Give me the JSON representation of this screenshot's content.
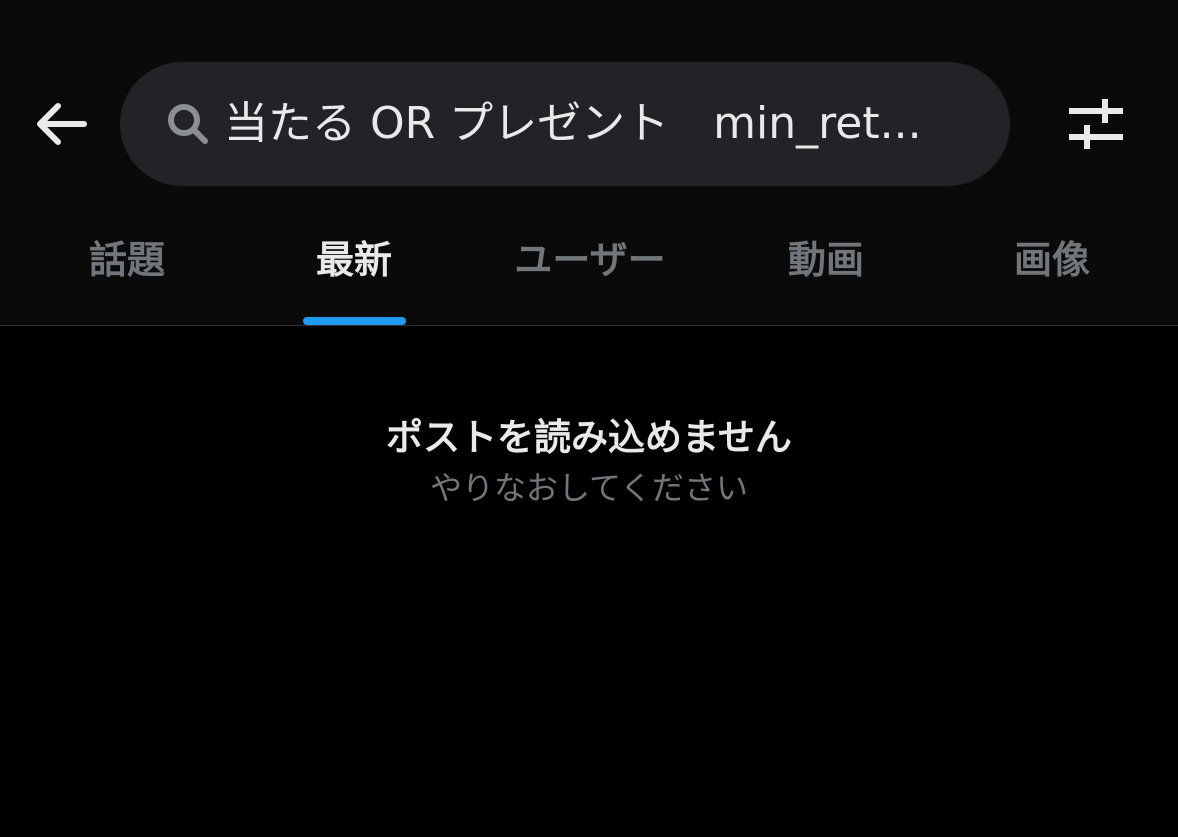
{
  "search": {
    "query": "当たる OR プレゼント　min_ret..."
  },
  "icons": {
    "back": "arrow-left-icon",
    "search": "search-icon",
    "filter": "sliders-icon"
  },
  "tabs": [
    {
      "label": "話題",
      "active": false
    },
    {
      "label": "最新",
      "active": true
    },
    {
      "label": "ユーザー",
      "active": false
    },
    {
      "label": "動画",
      "active": false
    },
    {
      "label": "画像",
      "active": false
    }
  ],
  "error": {
    "title": "ポストを読み込めません",
    "subtitle": "やりなおしてください"
  },
  "colors": {
    "background": "#000000",
    "header_background": "#0a0a0b",
    "search_background": "#212327",
    "accent": "#1d9bf0",
    "text_primary": "#e7e9ea",
    "text_secondary": "#71767b"
  }
}
